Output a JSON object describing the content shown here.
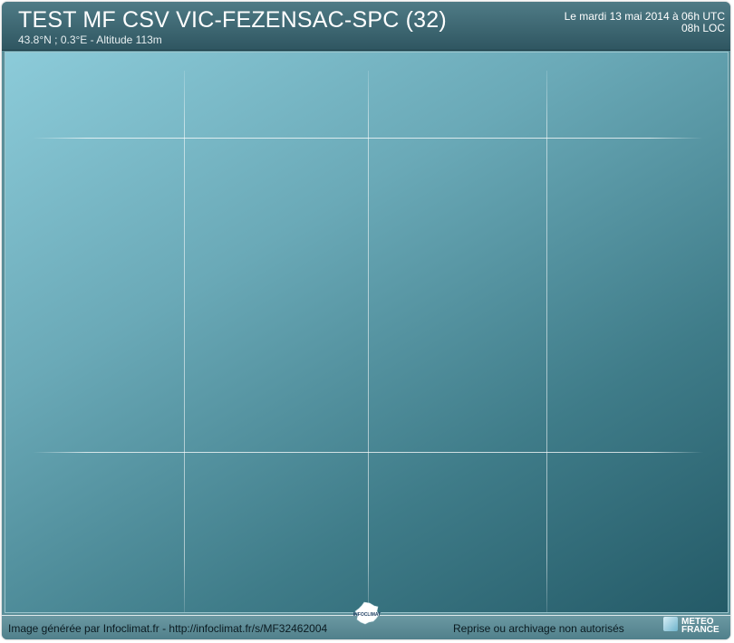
{
  "header": {
    "title": "TEST MF CSV VIC-FEZENSAC-SPC (32)",
    "subtitle": "43.8°N ; 0.3°E - Altitude 113m",
    "date_utc": "Le mardi 13 mai 2014 à 06h UTC",
    "date_loc": "08h LOC"
  },
  "footer": {
    "credit": "Image générée par Infoclimat.fr - http://infoclimat.fr/s/MF32462004",
    "rights": "Reprise ou archivage non autorisés",
    "logo_left_text": "INFOCLIMAT",
    "logo_right_line1": "METEO",
    "logo_right_line2": "FRANCE"
  },
  "colors": {
    "header_top": "#4f7b86",
    "header_bottom": "#2f5661",
    "plot_light": "#8ccbd9",
    "plot_dark": "#245a67",
    "grid": "#ffffff"
  },
  "icons": {
    "left_logo": "france-map-icon",
    "right_logo": "meteo-france-icon"
  }
}
